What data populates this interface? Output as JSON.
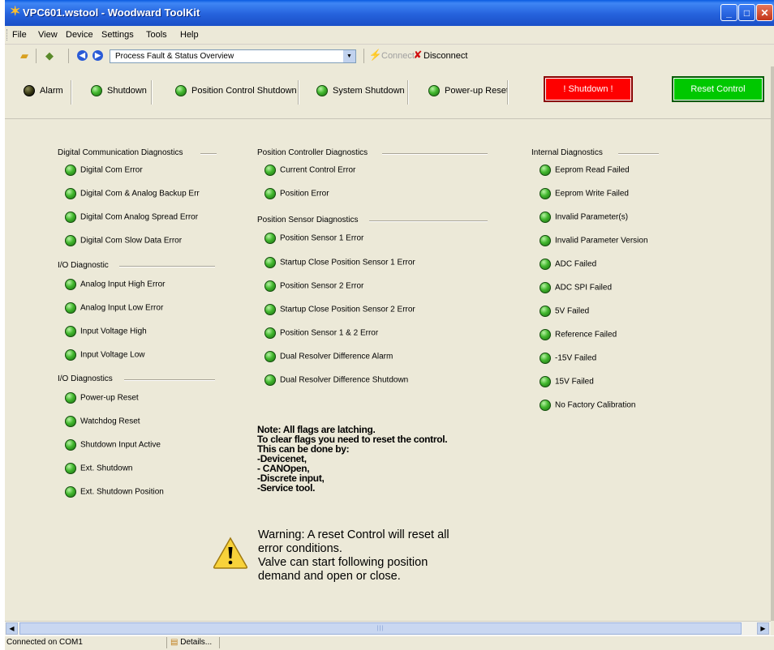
{
  "window": {
    "title": "VPC601.wstool - Woodward ToolKit"
  },
  "menu": [
    "File",
    "View",
    "Device",
    "Settings",
    "Tools",
    "Help"
  ],
  "toolbar": {
    "page_selector": "Process Fault & Status Overview",
    "connect_label": "Connect",
    "disconnect_label": "Disconnect"
  },
  "status_indicators": [
    {
      "label": "Alarm",
      "state": "off"
    },
    {
      "label": "Shutdown",
      "state": "on"
    },
    {
      "label": "Position Control Shutdown",
      "state": "on"
    },
    {
      "label": "System Shutdown",
      "state": "on"
    },
    {
      "label": "Power-up Reset",
      "state": "on"
    }
  ],
  "buttons": {
    "shutdown": "! Shutdown !",
    "reset": "Reset Control"
  },
  "colors": {
    "shutdown_button": "#fe0000",
    "reset_button": "#00c800",
    "led_on": "#43b82f",
    "led_off": "#3a3a16"
  },
  "digital_comm": {
    "title": "Digital Communication Diagnostics",
    "items": [
      "Digital Com Error",
      "Digital Com & Analog Backup Err",
      "Digital Com Analog Spread Error",
      "Digital Com Slow Data Error"
    ]
  },
  "io_diagnostic": {
    "title": "I/O Diagnostic",
    "items": [
      "Analog Input High Error",
      "Analog Input Low Error",
      "Input Voltage High",
      "Input Voltage Low"
    ]
  },
  "io_diagnostics": {
    "title": "I/O Diagnostics",
    "items": [
      "Power-up Reset",
      "Watchdog Reset",
      "Shutdown Input Active",
      "Ext. Shutdown",
      "Ext. Shutdown Position"
    ]
  },
  "position_controller": {
    "title": "Position Controller Diagnostics",
    "items": [
      "Current Control Error",
      "Position Error"
    ]
  },
  "position_sensor": {
    "title": "Position Sensor Diagnostics",
    "items": [
      "Position Sensor 1 Error",
      "Startup Close Position Sensor 1 Error",
      "Position Sensor 2 Error",
      "Startup Close Position Sensor 2 Error",
      "Position Sensor 1 & 2 Error",
      "Dual Resolver Difference Alarm",
      "Dual Resolver Difference Shutdown"
    ]
  },
  "internal": {
    "title": "Internal Diagnostics",
    "items": [
      "Eeprom Read Failed",
      "Eeprom Write Failed",
      "Invalid Parameter(s)",
      "Invalid Parameter Version",
      "ADC Failed",
      "ADC SPI Failed",
      "5V Failed",
      "Reference Failed",
      "-15V Failed",
      "15V Failed",
      "No Factory Calibration"
    ]
  },
  "note": {
    "lines": [
      "Note: All flags are latching.",
      "To clear flags you need to reset the control.",
      "This can be done by:",
      "-Devicenet,",
      "- CANOpen,",
      "-Discrete input,",
      "-Service tool."
    ]
  },
  "warning": {
    "lines": [
      "Warning: A reset Control will reset all",
      "error conditions.",
      "Valve can start following position",
      "demand and open or close."
    ]
  },
  "statusbar": {
    "connection": "Connected on COM1",
    "details": "Details..."
  }
}
